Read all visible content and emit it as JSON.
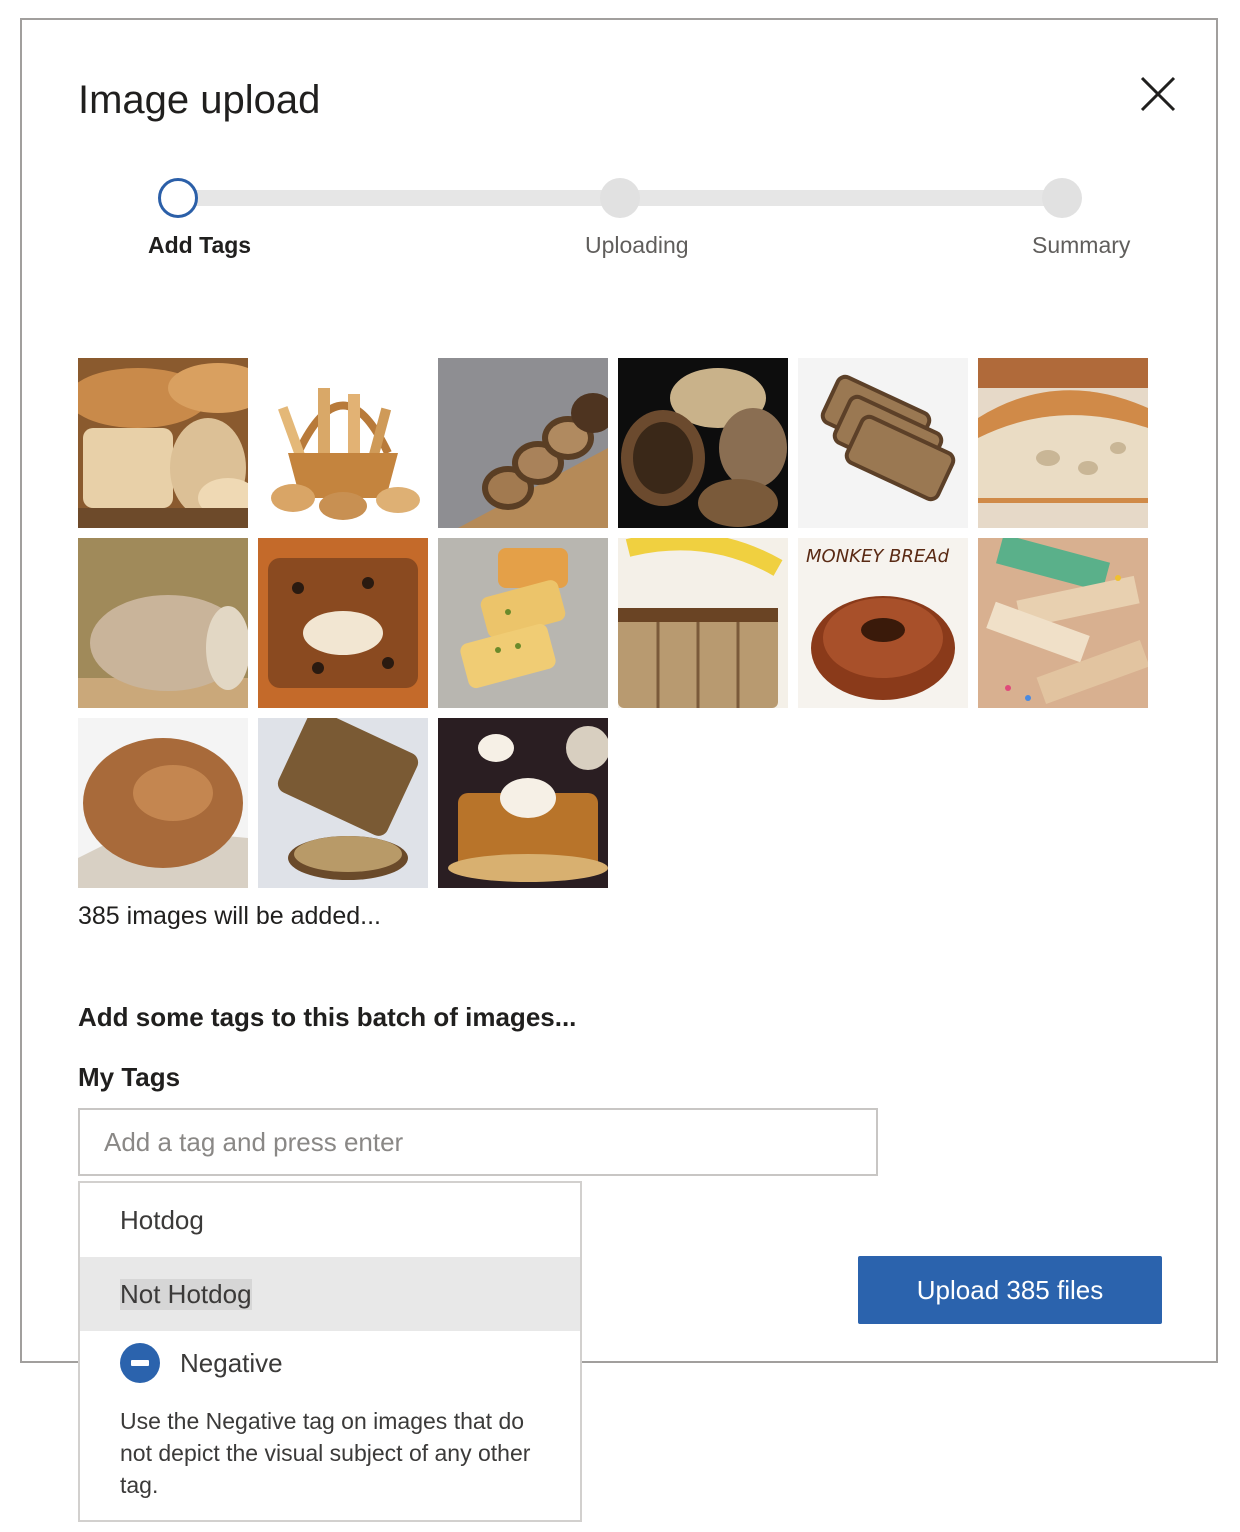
{
  "dialog": {
    "title": "Image upload",
    "close_icon": "close-icon"
  },
  "stepper": {
    "steps": [
      {
        "label": "Add Tags",
        "state": "active"
      },
      {
        "label": "Uploading",
        "state": "pending"
      },
      {
        "label": "Summary",
        "state": "pending"
      }
    ]
  },
  "images": {
    "thumbnails": [
      "bread-assortment",
      "bread-basket",
      "sliced-seeded-loaf",
      "rustic-sourdough-loaves",
      "sliced-rye-bread",
      "ciabatta-loaf",
      "country-loaf",
      "chocolate-chip-bread",
      "garlic-bread",
      "banana-bread",
      "monkey-bread",
      "fairy-bread"
    ],
    "monkey_bread_caption": "MONKEY BREAd",
    "count_text": "385 images will be added..."
  },
  "tagging": {
    "heading": "Add some tags to this batch of images...",
    "label": "My Tags",
    "input_placeholder": "Add a tag and press enter",
    "input_value": ""
  },
  "dropdown": {
    "options": [
      "Hotdog",
      "Not Hotdog"
    ],
    "negative": {
      "label": "Negative",
      "description": "Use the Negative tag on images that do not depict the visual subject of any other tag."
    }
  },
  "actions": {
    "upload_label": "Upload 385 files"
  },
  "colors": {
    "accent": "#2b63ad",
    "border": "#a19f9d",
    "highlight": "#e8e8e8"
  }
}
